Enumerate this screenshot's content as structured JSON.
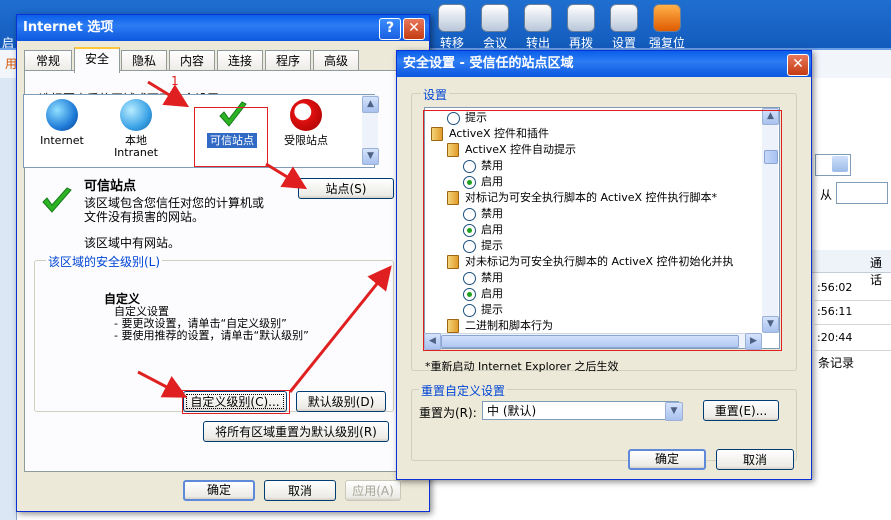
{
  "background_app": {
    "top_left_fragment": "启",
    "left_fragment": "用",
    "toolbar": [
      {
        "label": "转移",
        "icon": "transfer-icon"
      },
      {
        "label": "会议",
        "icon": "meeting-icon"
      },
      {
        "label": "转出",
        "icon": "transfer-out-icon"
      },
      {
        "label": "再拨",
        "icon": "redial-icon"
      },
      {
        "label": "设置",
        "icon": "settings-icon"
      },
      {
        "label": "强复位",
        "icon": "force-reset-icon"
      }
    ],
    "from_label": "从",
    "header_right": "通话",
    "times": [
      ":56:02",
      ":56:11",
      ":20:44"
    ],
    "records_text": "条记录"
  },
  "internet_options": {
    "title": "Internet 选项",
    "tabs": [
      "常规",
      "安全",
      "隐私",
      "内容",
      "连接",
      "程序",
      "高级"
    ],
    "active_tab": "安全",
    "zone_instruction": "选择要查看的区域或更改安全设置。",
    "zones": [
      {
        "label": "Internet",
        "icon": "globe-icon"
      },
      {
        "label": "本地\nIntranet",
        "icon": "intranet-icon"
      },
      {
        "label": "可信站点",
        "icon": "check-icon"
      },
      {
        "label": "受限站点",
        "icon": "restricted-icon"
      }
    ],
    "selected_zone": "可信站点",
    "zone_title": "可信站点",
    "zone_description": "该区域包含您信任对您的计算机或\n文件没有损害的网站。",
    "zone_no_sites": "该区域中有网站。",
    "sites_button": "站点(S)",
    "security_level_label": "该区域的安全级别(L)",
    "level_name": "自定义",
    "level_desc": "自定义设置\n - 要更改设置，请单击“自定义级别”\n - 要使用推荐的设置，请单击“默认级别”",
    "custom_level_button": "自定义级别(C)...",
    "default_level_button": "默认级别(D)",
    "reset_all_button": "将所有区域重置为默认级别(R)",
    "ok": "确定",
    "cancel": "取消",
    "apply": "应用(A)",
    "annotation_number": "1"
  },
  "security_settings": {
    "title": "安全设置 - 受信任的站点区域",
    "settings_group_label": "设置",
    "tree": [
      {
        "type": "radio",
        "label": "提示",
        "checked": false,
        "indent": 1
      },
      {
        "type": "category",
        "label": "ActiveX 控件和插件",
        "indent": 0
      },
      {
        "type": "setting",
        "label": "ActiveX 控件自动提示",
        "indent": 1
      },
      {
        "type": "radio",
        "label": "禁用",
        "checked": false,
        "indent": 2
      },
      {
        "type": "radio",
        "label": "启用",
        "checked": true,
        "indent": 2
      },
      {
        "type": "setting",
        "label": "对标记为可安全执行脚本的 ActiveX 控件执行脚本*",
        "indent": 1
      },
      {
        "type": "radio",
        "label": "禁用",
        "checked": false,
        "indent": 2
      },
      {
        "type": "radio",
        "label": "启用",
        "checked": true,
        "indent": 2
      },
      {
        "type": "radio",
        "label": "提示",
        "checked": false,
        "indent": 2
      },
      {
        "type": "setting",
        "label": "对未标记为可安全执行脚本的 ActiveX 控件初始化并执",
        "indent": 1
      },
      {
        "type": "radio",
        "label": "禁用",
        "checked": false,
        "indent": 2
      },
      {
        "type": "radio",
        "label": "启用",
        "checked": true,
        "indent": 2
      },
      {
        "type": "radio",
        "label": "提示",
        "checked": false,
        "indent": 2
      },
      {
        "type": "setting",
        "label": "二进制和脚本行为",
        "indent": 1
      }
    ],
    "restart_note": "*重新启动 Internet Explorer 之后生效",
    "reset_group_label": "重置自定义设置",
    "reset_to_label": "重置为(R):",
    "reset_to_value": "中 (默认)",
    "reset_button": "重置(E)...",
    "ok": "确定",
    "cancel": "取消"
  },
  "colors": {
    "title_bar": "#0a5fe8",
    "dialog_face": "#ece9d8",
    "highlight": "#e02020"
  }
}
